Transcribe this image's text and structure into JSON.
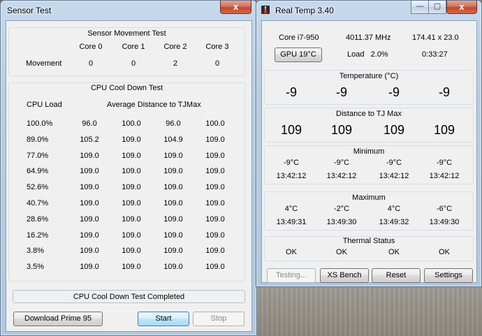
{
  "sensor_test": {
    "title": "Sensor Test",
    "close_glyph": "x",
    "movement": {
      "group_title": "Sensor Movement Test",
      "cores": [
        "Core 0",
        "Core 1",
        "Core 2",
        "Core 3"
      ],
      "row_label": "Movement",
      "values": [
        "0",
        "0",
        "2",
        "0"
      ]
    },
    "cooldown": {
      "group_title": "CPU Cool Down Test",
      "col_load": "CPU Load",
      "col_avg": "Average Distance to TJMax",
      "rows": [
        [
          "100.0%",
          "96.0",
          "100.0",
          "96.0",
          "100.0"
        ],
        [
          "89.0%",
          "105.2",
          "109.0",
          "104.9",
          "109.0"
        ],
        [
          "77.0%",
          "109.0",
          "109.0",
          "109.0",
          "109.0"
        ],
        [
          "64.9%",
          "109.0",
          "109.0",
          "109.0",
          "109.0"
        ],
        [
          "52.6%",
          "109.0",
          "109.0",
          "109.0",
          "109.0"
        ],
        [
          "40.7%",
          "109.0",
          "109.0",
          "109.0",
          "109.0"
        ],
        [
          "28.6%",
          "109.0",
          "109.0",
          "109.0",
          "109.0"
        ],
        [
          "16.2%",
          "109.0",
          "109.0",
          "109.0",
          "109.0"
        ],
        [
          "3.8%",
          "109.0",
          "109.0",
          "109.0",
          "109.0"
        ],
        [
          "3.5%",
          "109.0",
          "109.0",
          "109.0",
          "109.0"
        ]
      ]
    },
    "status_text": "CPU Cool Down Test Completed",
    "buttons": {
      "download": "Download Prime 95",
      "start": "Start",
      "stop": "Stop"
    }
  },
  "real_temp": {
    "title": "Real Temp 3.40",
    "caption": {
      "minimize": "—",
      "maximize": "▢",
      "close": "x"
    },
    "cpu": {
      "model": "Core i7-950",
      "mhz": "4011.37 MHz",
      "multiplier": "174.41 x 23.0",
      "gpu_button": "GPU  19°C",
      "load": "Load   2.0%",
      "uptime": "0:33:27"
    },
    "temperature": {
      "title": "Temperature (°C)",
      "values": [
        "-9",
        "-9",
        "-9",
        "-9"
      ]
    },
    "distance": {
      "title": "Distance to TJ Max",
      "values": [
        "109",
        "109",
        "109",
        "109"
      ]
    },
    "minimum": {
      "title": "Minimum",
      "temps": [
        "-9°C",
        "-9°C",
        "-9°C",
        "-9°C"
      ],
      "times": [
        "13:42:12",
        "13:42:12",
        "13:42:12",
        "13:42:12"
      ]
    },
    "maximum": {
      "title": "Maximum",
      "temps": [
        "4°C",
        "-2°C",
        "4°C",
        "-6°C"
      ],
      "times": [
        "13:49:31",
        "13:49:30",
        "13:49:32",
        "13:49:30"
      ]
    },
    "thermal": {
      "title": "Thermal Status",
      "values": [
        "OK",
        "OK",
        "OK",
        "OK"
      ]
    },
    "buttons": {
      "testing": "Testing...",
      "xs_bench": "XS Bench",
      "reset": "Reset",
      "settings": "Settings"
    }
  },
  "colors": {
    "accent_blue": "#3c7fb1",
    "close_red": "#c04a2b",
    "window_frame": "#b8cde3"
  }
}
